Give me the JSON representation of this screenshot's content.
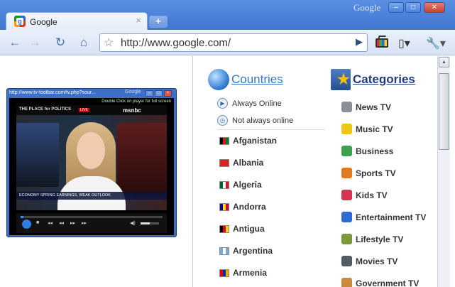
{
  "window": {
    "brand": "Google",
    "minimize_glyph": "–",
    "maximize_glyph": "□",
    "close_glyph": "✕"
  },
  "tab": {
    "favicon_letter": "g",
    "title": "Google",
    "close_glyph": "×",
    "new_tab_glyph": "+"
  },
  "toolbar": {
    "back_glyph": "←",
    "forward_glyph": "→",
    "reload_glyph": "↻",
    "home_glyph": "⌂",
    "star_glyph": "☆",
    "url": "http://www.google.com/",
    "go_glyph": "▶",
    "page_menu_glyph": "▯▾",
    "wrench_glyph": "🔧▾",
    "icons": [
      "back-icon",
      "forward-icon",
      "reload-icon",
      "home-icon",
      "bookmark-star-icon",
      "go-icon",
      "tv-toolbar-icon",
      "page-menu-icon",
      "wrench-icon"
    ]
  },
  "player": {
    "title": "http://www.tv-toolbar.com/tv.php?sour...",
    "brand": "Google",
    "hint": "Double Click on player for full screen",
    "show": "THE PLACE for POLITICS",
    "live": "LIVE",
    "network": "msnbc",
    "ticker": "ECONOMY  SPRING EARNINGS, WEAK OUTLOOK",
    "progress": 0.02,
    "volume": 0.5
  },
  "panel": {
    "countries_title": "Countries",
    "categories_title": "Categories",
    "options": [
      {
        "label": "Always Online",
        "icon": "play-circle-icon",
        "glyph": "▶"
      },
      {
        "label": "Not always online",
        "icon": "clock-icon",
        "glyph": "◷"
      }
    ],
    "countries": [
      {
        "name": "Afganistan",
        "flag": [
          "#000000",
          "#d32011",
          "#007a36"
        ]
      },
      {
        "name": "Albania",
        "flag": [
          "#e41e20",
          "#e41e20",
          "#e41e20"
        ]
      },
      {
        "name": "Algeria",
        "flag": [
          "#006233",
          "#ffffff",
          "#d21034"
        ]
      },
      {
        "name": "Andorra",
        "flag": [
          "#10069f",
          "#fedf00",
          "#d50032"
        ]
      },
      {
        "name": "Antigua",
        "flag": [
          "#000000",
          "#ce1126",
          "#fcd116"
        ]
      },
      {
        "name": "Argentina",
        "flag": [
          "#74acdf",
          "#ffffff",
          "#74acdf"
        ]
      },
      {
        "name": "Armenia",
        "flag": [
          "#d90012",
          "#0033a0",
          "#f2a800"
        ]
      }
    ],
    "categories": [
      {
        "name": "News TV",
        "icon": "news-tv-icon",
        "color": "#8a8f99"
      },
      {
        "name": "Music TV",
        "icon": "music-tv-icon",
        "color": "#f0c419"
      },
      {
        "name": "Business",
        "icon": "business-icon",
        "color": "#3fa34d"
      },
      {
        "name": "Sports TV",
        "icon": "sports-tv-icon",
        "color": "#e07b22"
      },
      {
        "name": "Kids TV",
        "icon": "kids-tv-icon",
        "color": "#d8344f"
      },
      {
        "name": "Entertainment TV",
        "icon": "entertainment-tv-icon",
        "color": "#2f6ad0"
      },
      {
        "name": "Lifestyle TV",
        "icon": "lifestyle-tv-icon",
        "color": "#7a9a3a"
      },
      {
        "name": "Movies TV",
        "icon": "movies-tv-icon",
        "color": "#555a66"
      },
      {
        "name": "Government TV",
        "icon": "government-tv-icon",
        "color": "#c98a3c"
      }
    ]
  },
  "scrollbar": {
    "up_glyph": "▲"
  }
}
